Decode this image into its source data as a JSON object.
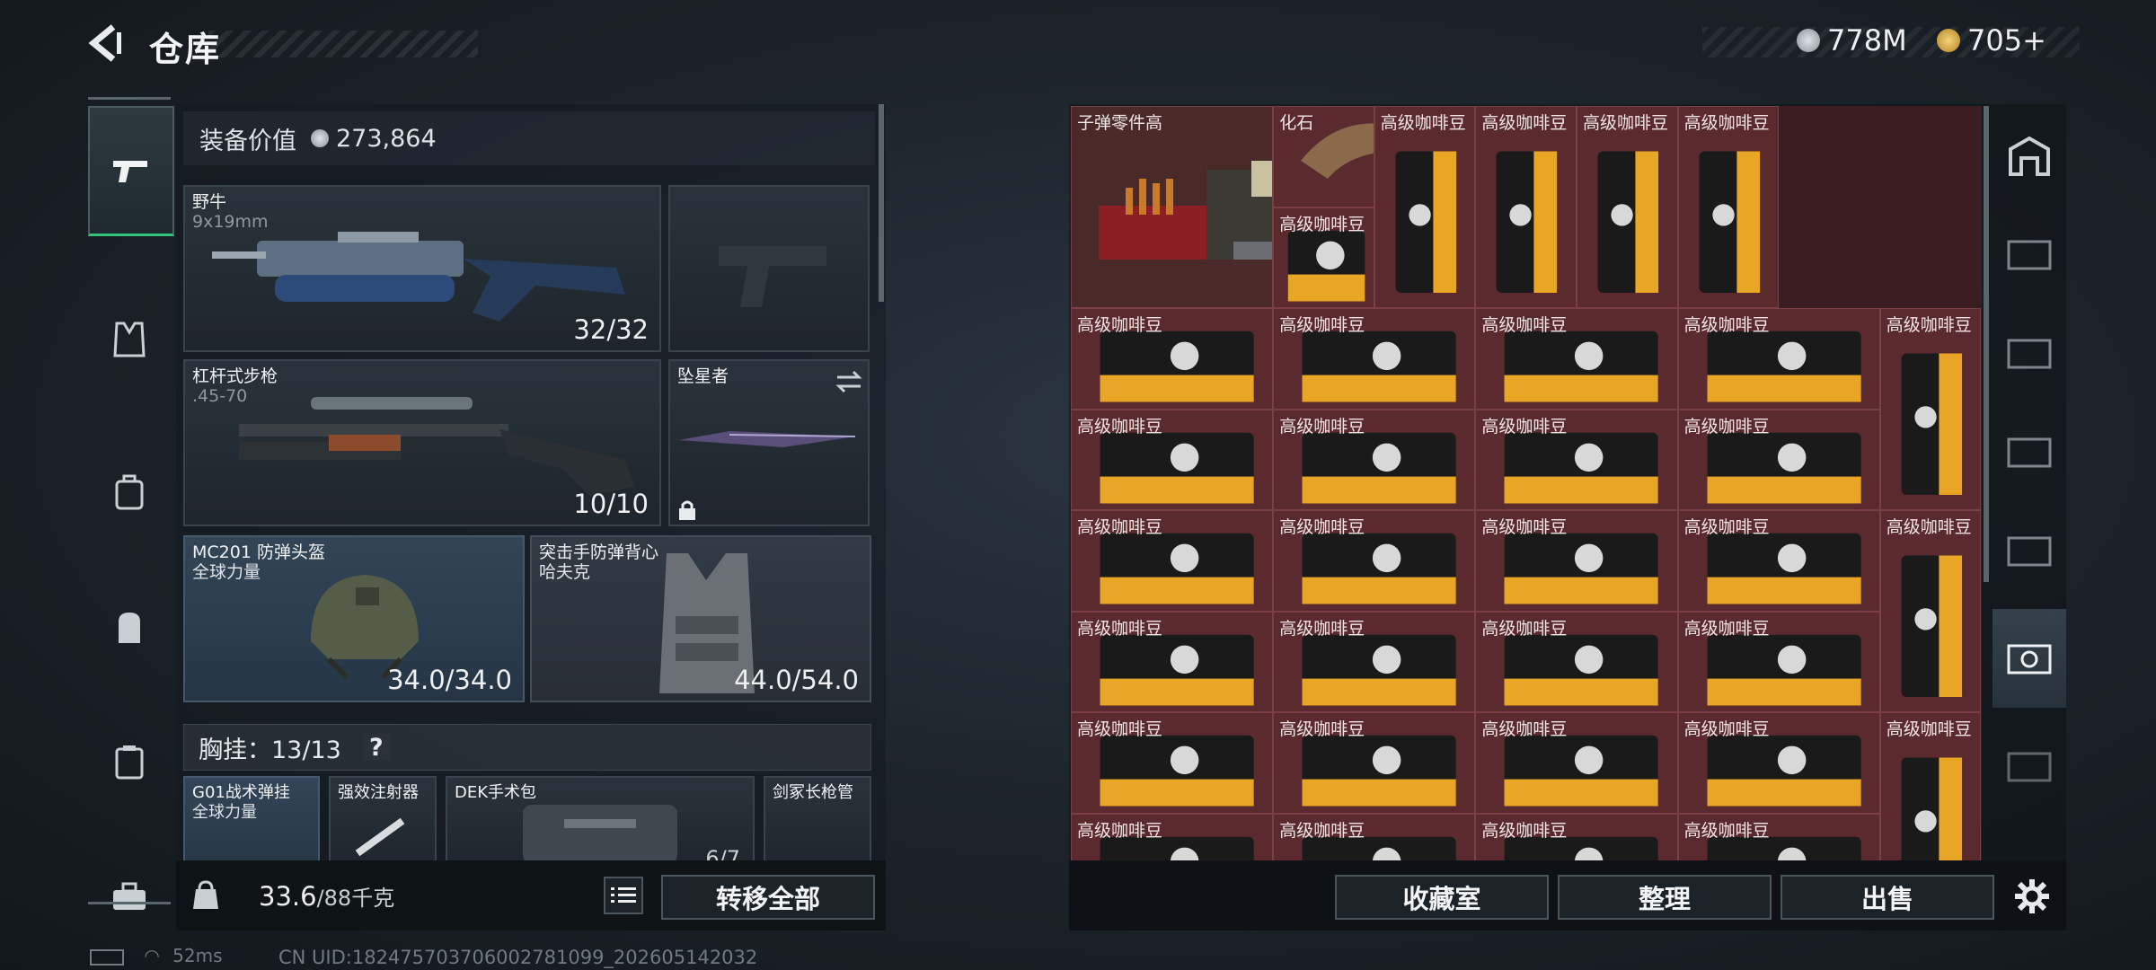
{
  "header": {
    "title": "仓库",
    "currency_silver": "778M",
    "currency_gold": "705+"
  },
  "equipment": {
    "value_label": "装备价值",
    "value": "273,864",
    "primary_weapon": {
      "name": "野牛",
      "caliber": "9x19mm",
      "ammo": "32/32"
    },
    "rifle": {
      "name": "杠杆式步枪",
      "caliber": ".45-70",
      "ammo": "10/10"
    },
    "melee": {
      "name": "坠星者"
    },
    "helmet": {
      "name": "MC201 防弹头盔",
      "brand": "全球力量",
      "durability": "34.0/34.0"
    },
    "vest": {
      "name": "突击手防弹背心",
      "brand": "哈夫克",
      "durability": "44.0/54.0"
    },
    "chest": {
      "label": "胸挂：13/13"
    },
    "chest_items": [
      {
        "name": "G01战术弹挂",
        "brand": "全球力量"
      },
      {
        "name": "强效注射器"
      },
      {
        "name": "DEK手术包",
        "count": "6/7"
      },
      {
        "name": "剑冢长枪管"
      }
    ],
    "weight": "33.6",
    "weight_max": "/88千克",
    "transfer_all": "转移全部"
  },
  "storage": {
    "items": [
      {
        "label": "子弹零件高",
        "kind": "ammo"
      },
      {
        "label": "化石",
        "kind": "fossil"
      },
      {
        "label": "高级咖啡豆",
        "kind": "bag"
      }
    ],
    "buttons": {
      "collection": "收藏室",
      "organize": "整理",
      "sell": "出售"
    }
  },
  "status": {
    "ping": "52ms",
    "uid": "CN UID:1824757037060027810​99_202605142032"
  },
  "colors": {
    "active_green": "#33c47a",
    "item_red": "#5a2a2e",
    "coffee_gold": "#e8a526"
  }
}
